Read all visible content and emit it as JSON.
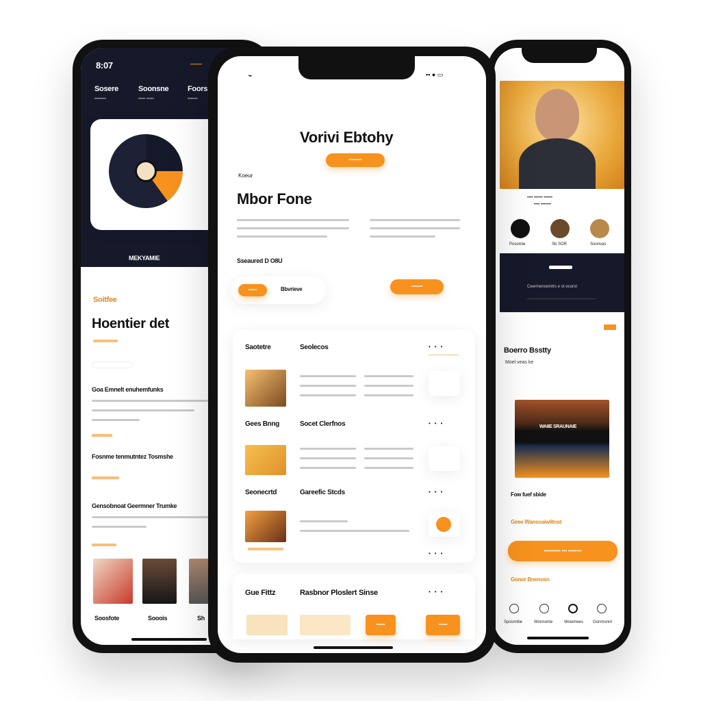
{
  "colors": {
    "accent": "#f7921e",
    "dark": "#16192a",
    "bg": "#ffffff"
  },
  "left": {
    "time": "8:07",
    "status": "••••••••",
    "nav": [
      {
        "label": "Sosere",
        "sub": "••••••••"
      },
      {
        "label": "Soonsne",
        "sub": "••••• •••••"
      },
      {
        "label": "Foors",
        "sub": "•••••••"
      }
    ],
    "album_title": "MEKYAMIE",
    "tag": "Soitfee",
    "headline": "Hoentier det",
    "section1": "Goa Emnelt enuhemfunks",
    "section2": "Fosnme tenmutntez Tosmshe",
    "section3": "Gensobnoat Geermner Trumke",
    "people": [
      {
        "name": "Soosfote"
      },
      {
        "name": "Sooois"
      },
      {
        "name": "Sh"
      }
    ]
  },
  "mid": {
    "title": "Vorivi Ebtohy",
    "top_button": "•••••••••",
    "kicker": "Koeur",
    "headline": "Mbor Fone",
    "meta": "Sseaured D O8U",
    "pill_small": "••••••",
    "ghost_label": "Bbvrieve",
    "right_button": "••••••••",
    "list_headers": [
      {
        "left": "Saotetre",
        "right": "Seolecos"
      },
      {
        "left": "Gees Bnng",
        "right": "Socet Clerfnos"
      },
      {
        "left": "Seonecrtd",
        "right": "Gareefic Stcds"
      }
    ],
    "bottom_left": "Gue Fittz",
    "bottom_right": "Rasbnor Ploslert Sinse",
    "bottom_button": "••••••"
  },
  "right": {
    "caption1": "•••• •••••• ••••••",
    "caption2": "•••• •••••••",
    "icons": [
      {
        "label": "Posomie"
      },
      {
        "label": "Sb SOR"
      },
      {
        "label": "Soonvas"
      }
    ],
    "dark_caption": "Ceermenoemtrs e ot ecorot",
    "section_title": "Boerro Bsstty",
    "section_sub": "Moel veas ke",
    "banner_label": "WAIIE SRAUNAIE",
    "row1": "Fow fuef sbide",
    "row2": "Geee Wansoaiwlitnst",
    "cta": "••••••••••  •••  ••••••••",
    "link": "Gonor Bnenosn",
    "tabs": [
      {
        "label": "Sposmtbe"
      },
      {
        "label": "Wonnonte"
      },
      {
        "label": "Wowmees"
      },
      {
        "label": "Gonmonnt"
      }
    ]
  }
}
